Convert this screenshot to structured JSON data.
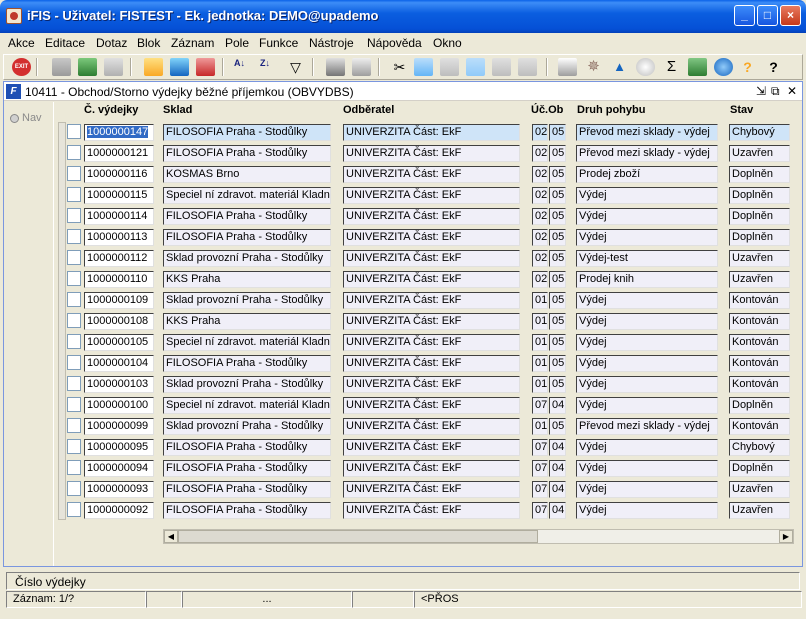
{
  "window": {
    "title": "iFIS - Uživatel: FISTEST - Ek. jednotka: DEMO@upademo"
  },
  "menu": [
    "Akce",
    "Editace",
    "Dotaz",
    "Blok",
    "Záznam",
    "Pole",
    "Funkce",
    "Nástroje",
    "Nápověda",
    "Okno"
  ],
  "toolbar": {
    "exit_label": "EXIT",
    "sum_label": "Σ"
  },
  "form": {
    "title": "10411 - Obchod/Storno výdejky běžné příjemkou (OBVYDBS)",
    "nav_label": "Nav",
    "headers": {
      "cislo": "Č. výdejky",
      "sklad": "Sklad",
      "odberatel": "Odběratel",
      "ucob": "Úč.Ob",
      "druh": "Druh pohybu",
      "stav": "Stav"
    }
  },
  "rows": [
    {
      "cislo": "1000000147",
      "sklad": "FILOSOFIA Praha - Stodůlky",
      "odberatel": "UNIVERZITA Část: EkF",
      "uc": "02",
      "ob": "05",
      "druh": "Převod mezi sklady - výdej",
      "stav": "Chybový"
    },
    {
      "cislo": "1000000121",
      "sklad": "FILOSOFIA Praha - Stodůlky",
      "odberatel": "UNIVERZITA Část: EkF",
      "uc": "02",
      "ob": "05",
      "druh": "Převod mezi sklady - výdej",
      "stav": "Uzavřen"
    },
    {
      "cislo": "1000000116",
      "sklad": "KOSMAS Brno",
      "odberatel": "UNIVERZITA Část: EkF",
      "uc": "02",
      "ob": "05",
      "druh": "Prodej zboží",
      "stav": "Doplněn"
    },
    {
      "cislo": "1000000115",
      "sklad": "Speciel ní zdravot. materiál Kladno",
      "odberatel": "UNIVERZITA Část: EkF",
      "uc": "02",
      "ob": "05",
      "druh": "Výdej",
      "stav": "Doplněn"
    },
    {
      "cislo": "1000000114",
      "sklad": "FILOSOFIA Praha - Stodůlky",
      "odberatel": "UNIVERZITA Část: EkF",
      "uc": "02",
      "ob": "05",
      "druh": "Výdej",
      "stav": "Doplněn"
    },
    {
      "cislo": "1000000113",
      "sklad": "FILOSOFIA Praha - Stodůlky",
      "odberatel": "UNIVERZITA Část: EkF",
      "uc": "02",
      "ob": "05",
      "druh": "Výdej",
      "stav": "Doplněn"
    },
    {
      "cislo": "1000000112",
      "sklad": "Sklad provozní Praha - Stodůlky",
      "odberatel": "UNIVERZITA Část: EkF",
      "uc": "02",
      "ob": "05",
      "druh": "Výdej-test",
      "stav": "Uzavřen"
    },
    {
      "cislo": "1000000110",
      "sklad": "KKS Praha",
      "odberatel": "UNIVERZITA Část: EkF",
      "uc": "02",
      "ob": "05",
      "druh": "Prodej knih",
      "stav": "Uzavřen"
    },
    {
      "cislo": "1000000109",
      "sklad": "Sklad provozní Praha - Stodůlky",
      "odberatel": "UNIVERZITA Část: EkF",
      "uc": "01",
      "ob": "05",
      "druh": "Výdej",
      "stav": "Kontován"
    },
    {
      "cislo": "1000000108",
      "sklad": "KKS Praha",
      "odberatel": "UNIVERZITA Část: EkF",
      "uc": "01",
      "ob": "05",
      "druh": "Výdej",
      "stav": "Kontován"
    },
    {
      "cislo": "1000000105",
      "sklad": "Speciel ní zdravot. materiál Kladno",
      "odberatel": "UNIVERZITA Část: EkF",
      "uc": "01",
      "ob": "05",
      "druh": "Výdej",
      "stav": "Kontován"
    },
    {
      "cislo": "1000000104",
      "sklad": "FILOSOFIA Praha - Stodůlky",
      "odberatel": "UNIVERZITA Část: EkF",
      "uc": "01",
      "ob": "05",
      "druh": "Výdej",
      "stav": "Kontován"
    },
    {
      "cislo": "1000000103",
      "sklad": "Sklad provozní Praha - Stodůlky",
      "odberatel": "UNIVERZITA Část: EkF",
      "uc": "01",
      "ob": "05",
      "druh": "Výdej",
      "stav": "Kontován"
    },
    {
      "cislo": "1000000100",
      "sklad": "Speciel ní zdravot. materiál Kladno",
      "odberatel": "UNIVERZITA Část: EkF",
      "uc": "07",
      "ob": "04",
      "druh": "Výdej",
      "stav": "Doplněn"
    },
    {
      "cislo": "1000000099",
      "sklad": "Sklad provozní Praha - Stodůlky",
      "odberatel": "UNIVERZITA Část: EkF",
      "uc": "01",
      "ob": "05",
      "druh": "Převod mezi sklady - výdej",
      "stav": "Kontován"
    },
    {
      "cislo": "1000000095",
      "sklad": "FILOSOFIA Praha - Stodůlky",
      "odberatel": "UNIVERZITA Část: EkF",
      "uc": "07",
      "ob": "04",
      "druh": "Výdej",
      "stav": "Chybový"
    },
    {
      "cislo": "1000000094",
      "sklad": "FILOSOFIA Praha - Stodůlky",
      "odberatel": "UNIVERZITA Část: EkF",
      "uc": "07",
      "ob": "04",
      "druh": "Výdej",
      "stav": "Doplněn"
    },
    {
      "cislo": "1000000093",
      "sklad": "FILOSOFIA Praha - Stodůlky",
      "odberatel": "UNIVERZITA Část: EkF",
      "uc": "07",
      "ob": "04",
      "druh": "Výdej",
      "stav": "Uzavřen"
    },
    {
      "cislo": "1000000092",
      "sklad": "FILOSOFIA Praha - Stodůlky",
      "odberatel": "UNIVERZITA Část: EkF",
      "uc": "07",
      "ob": "04",
      "druh": "Výdej",
      "stav": "Uzavřen"
    }
  ],
  "status": {
    "hint": "Číslo výdejky",
    "record": "Záznam: 1/?",
    "ellipsis": "...",
    "mode": "<PŘOS"
  }
}
